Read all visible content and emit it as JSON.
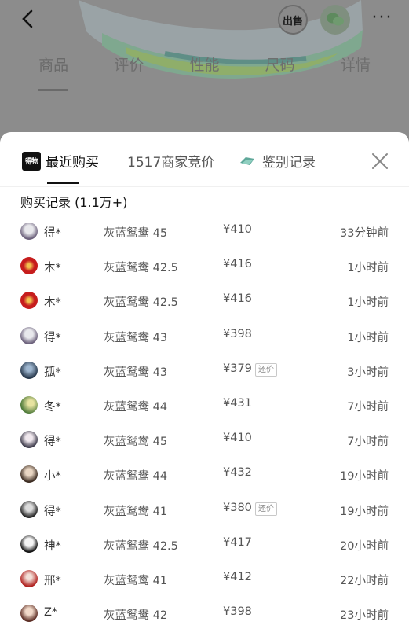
{
  "topbar": {
    "back_icon": "chevron-left-icon",
    "sell_label": "出售",
    "share_icon": "wechat-icon",
    "more_label": "···"
  },
  "page_tabs": [
    {
      "label": "商品",
      "active": true
    },
    {
      "label": "评价"
    },
    {
      "label": "性能"
    },
    {
      "label": "尺码"
    },
    {
      "label": "详情"
    }
  ],
  "sheet": {
    "tabs": [
      {
        "label": "最近购买",
        "active": true,
        "icon": "得物-logo"
      },
      {
        "label": "1517商家竞价"
      },
      {
        "label": "鉴别记录",
        "icon": "authentication-icon"
      }
    ],
    "close_icon": "close-icon",
    "list_title": "购买记录 (1.1万+)",
    "colors": {
      "avatar_red": "#cc1f1f",
      "text": "#555555"
    },
    "records": [
      {
        "name": "得*",
        "model": "灰蓝鸳鸯 45",
        "price": "¥410",
        "tag": "",
        "time": "33分钟前"
      },
      {
        "name": "木*",
        "model": "灰蓝鸳鸯 42.5",
        "price": "¥416",
        "tag": "",
        "time": "1小时前"
      },
      {
        "name": "木*",
        "model": "灰蓝鸳鸯 42.5",
        "price": "¥416",
        "tag": "",
        "time": "1小时前"
      },
      {
        "name": "得*",
        "model": "灰蓝鸳鸯 43",
        "price": "¥398",
        "tag": "",
        "time": "1小时前"
      },
      {
        "name": "孤*",
        "model": "灰蓝鸳鸯 43",
        "price": "¥379",
        "tag": "还价",
        "time": "3小时前"
      },
      {
        "name": "冬*",
        "model": "灰蓝鸳鸯 44",
        "price": "¥431",
        "tag": "",
        "time": "7小时前"
      },
      {
        "name": "得*",
        "model": "灰蓝鸳鸯 45",
        "price": "¥410",
        "tag": "",
        "time": "7小时前"
      },
      {
        "name": "小*",
        "model": "灰蓝鸳鸯 44",
        "price": "¥432",
        "tag": "",
        "time": "19小时前"
      },
      {
        "name": "得*",
        "model": "灰蓝鸳鸯 41",
        "price": "¥380",
        "tag": "还价",
        "time": "19小时前"
      },
      {
        "name": "神*",
        "model": "灰蓝鸳鸯 42.5",
        "price": "¥417",
        "tag": "",
        "time": "20小时前"
      },
      {
        "name": "邢*",
        "model": "灰蓝鸳鸯 41",
        "price": "¥412",
        "tag": "",
        "time": "22小时前"
      },
      {
        "name": "Z*",
        "model": "灰蓝鸳鸯 42",
        "price": "¥398",
        "tag": "",
        "time": "23小时前"
      }
    ]
  }
}
